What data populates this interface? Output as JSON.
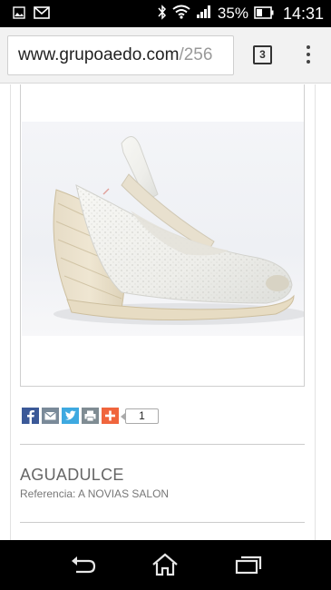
{
  "status_bar": {
    "battery_percent": "35%",
    "time": "14:31",
    "icons": [
      "image-icon",
      "gmail-icon",
      "bluetooth-icon",
      "wifi-icon",
      "signal-icon",
      "battery-icon"
    ]
  },
  "browser": {
    "url_domain": "www.grupoaedo.com",
    "url_path": "/256",
    "tab_count": "3",
    "menu_icon": "overflow-menu-icon"
  },
  "product": {
    "image_description_icon": "espadrille-wedge-sandal",
    "brand": "AGUADULCE",
    "reference_label": "Referencia:",
    "reference_value": "A NOVIAS SALON",
    "share_buttons": [
      {
        "name": "facebook",
        "color": "#3b5998",
        "glyph": "f"
      },
      {
        "name": "email",
        "color": "#7a8a99",
        "glyph": "✉"
      },
      {
        "name": "twitter",
        "color": "#3ea9e0",
        "glyph": "t"
      },
      {
        "name": "print",
        "color": "#7f8c93",
        "glyph": "⎙"
      },
      {
        "name": "addthis",
        "color": "#f0653d",
        "glyph": "+"
      }
    ],
    "share_count": "1"
  },
  "nav_bar": {
    "buttons": [
      "back-icon",
      "home-icon",
      "recent-apps-icon"
    ]
  }
}
